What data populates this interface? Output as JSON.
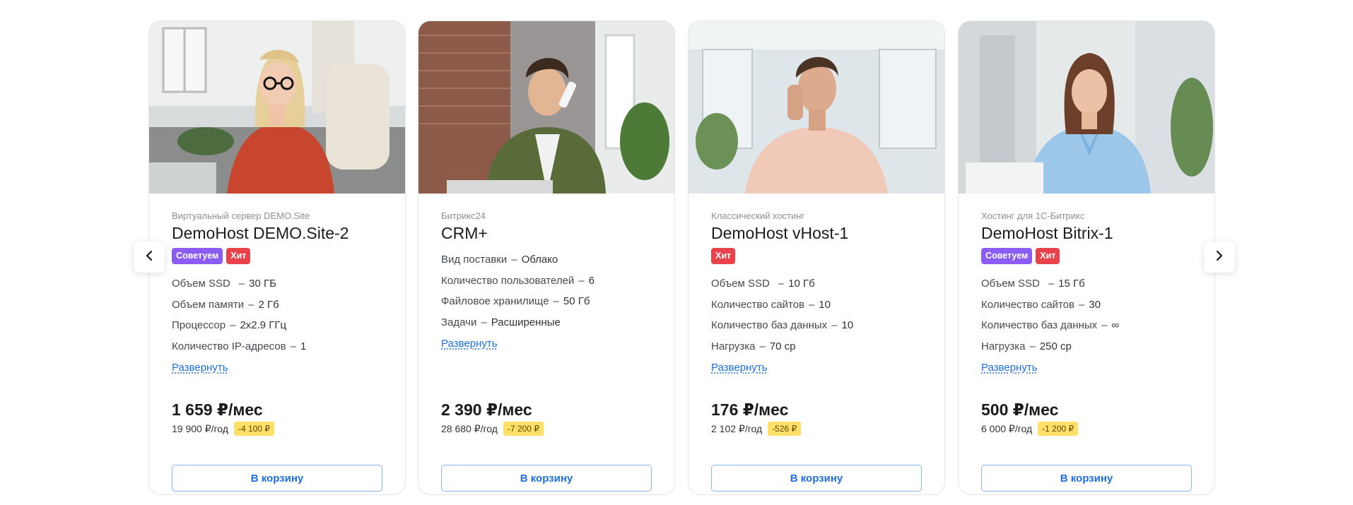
{
  "nav": {
    "prev_icon": "chevron-left-icon",
    "next_icon": "chevron-right-icon"
  },
  "cards": [
    {
      "category": "Виртуальный сервер DEMO.Site",
      "title": "DemoHost DEMO.Site-2",
      "badges": [
        {
          "label": "Советуем",
          "color": "#8c5bf1"
        },
        {
          "label": "Хит",
          "color": "#e8424b"
        }
      ],
      "specs": [
        {
          "name": "Объем SSD",
          "value": "30 ГБ"
        },
        {
          "name": "Объем памяти",
          "value": "2 Гб"
        },
        {
          "name": "Процессор",
          "value": "2x2.9 ГГц"
        },
        {
          "name": "Количество IP-адресов",
          "value": "1"
        }
      ],
      "expand": "Развернуть",
      "price": "1 659 ₽/мес",
      "yearly": "19 900 ₽/год",
      "discount": "-4 100 ₽",
      "button": "В корзину"
    },
    {
      "category": "Битрикс24",
      "title": "CRM+",
      "badges": [],
      "specs": [
        {
          "name": "Вид поставки",
          "value": "Облако"
        },
        {
          "name": "Количество пользователей",
          "value": "6"
        },
        {
          "name": "Файловое хранилище",
          "value": "50 Гб"
        },
        {
          "name": "Задачи",
          "value": "Расширенные"
        }
      ],
      "expand": "Развернуть",
      "price": "2 390 ₽/мес",
      "yearly": "28 680 ₽/год",
      "discount": "-7 200 ₽",
      "button": "В корзину"
    },
    {
      "category": "Классический хостинг",
      "title": "DemoHost vHost-1",
      "badges": [
        {
          "label": "Хит",
          "color": "#e8424b"
        }
      ],
      "specs": [
        {
          "name": "Объем SSD",
          "value": "10 Гб"
        },
        {
          "name": "Количество сайтов",
          "value": "10"
        },
        {
          "name": "Количество баз данных",
          "value": "10"
        },
        {
          "name": "Нагрузка",
          "value": "70 cp"
        }
      ],
      "expand": "Развернуть",
      "price": "176 ₽/мес",
      "yearly": "2 102 ₽/год",
      "discount": "-526 ₽",
      "button": "В корзину"
    },
    {
      "category": "Хостинг для 1С-Битрикс",
      "title": "DemoHost Bitrix-1",
      "badges": [
        {
          "label": "Советуем",
          "color": "#8c5bf1"
        },
        {
          "label": "Хит",
          "color": "#e8424b"
        }
      ],
      "specs": [
        {
          "name": "Объем SSD",
          "value": "15 Гб"
        },
        {
          "name": "Количество сайтов",
          "value": "30"
        },
        {
          "name": "Количество баз данных",
          "value": "∞"
        },
        {
          "name": "Нагрузка",
          "value": "250 cp"
        }
      ],
      "expand": "Развернуть",
      "price": "500 ₽/мес",
      "yearly": "6 000 ₽/год",
      "discount": "-1 200 ₽",
      "button": "В корзину"
    }
  ]
}
